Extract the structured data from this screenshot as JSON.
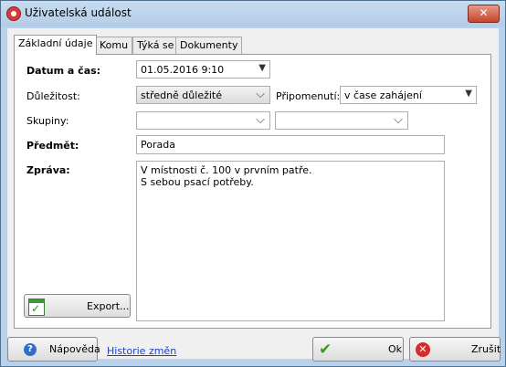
{
  "window": {
    "title": "Uživatelská událost",
    "close_glyph": "✕"
  },
  "tabs": [
    {
      "label": "Základní údaje"
    },
    {
      "label": "Komu"
    },
    {
      "label": "Týká se"
    },
    {
      "label": "Dokumenty"
    }
  ],
  "form": {
    "datetime_label": "Datum a čas:",
    "datetime_value": "01.05.2016 9:10",
    "importance_label": "Důležitost:",
    "importance_value": "středně důležité",
    "reminder_label": "Připomenutí:",
    "reminder_value": "v čase zahájení",
    "groups_label": "Skupiny:",
    "group1_value": "",
    "group2_value": "",
    "subject_label": "Předmět:",
    "subject_value": "Porada",
    "message_label": "Zpráva:",
    "message_value": "V místnosti č. 100 v prvním patře.\nS sebou psací potřeby.",
    "export_label": "Export..."
  },
  "footer": {
    "help_label": "Nápověda",
    "history_link": "Historie změn",
    "ok_label": "Ok",
    "cancel_label": "Zrušit"
  },
  "icons": {
    "app": "app-record-icon",
    "calendar": "calendar-check-icon",
    "help": "help-icon",
    "ok": "checkmark-icon",
    "cancel": "cancel-icon"
  }
}
